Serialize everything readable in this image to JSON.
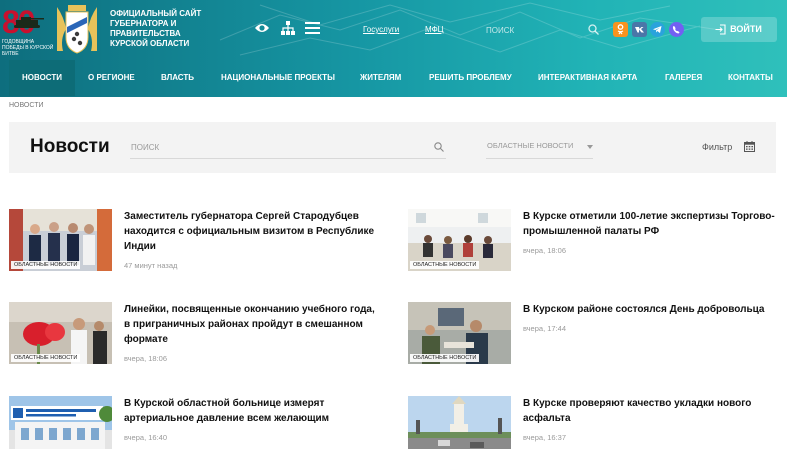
{
  "header": {
    "anniversary_number": "80",
    "anniversary_text": "ГОДОВЩИНА ПОБЕДЫ В КУРСКОЙ БИТВЕ",
    "site_title": "ОФИЦИАЛЬНЫЙ САЙТ ГУБЕРНАТОРА И ПРАВИТЕЛЬСТВА КУРСКОЙ ОБЛАСТИ",
    "links": [
      "Госуслуги",
      "МФЦ"
    ],
    "search_placeholder": "ПОИСК",
    "social_icons": [
      "odnoklassniki-icon",
      "vk-icon",
      "telegram-icon",
      "viber-icon"
    ],
    "social_colors": [
      "#f7931e",
      "#4a76a8",
      "#2aa3dc",
      "#7360f2"
    ],
    "login_label": "ВОЙТИ"
  },
  "nav": {
    "items": [
      "НОВОСТИ",
      "О РЕГИОНЕ",
      "ВЛАСТЬ",
      "НАЦИОНАЛЬНЫЕ ПРОЕКТЫ",
      "ЖИТЕЛЯМ",
      "РЕШИТЬ ПРОБЛЕМУ",
      "ИНТЕРАКТИВНАЯ КАРТА",
      "ГАЛЕРЕЯ",
      "КОНТАКТЫ"
    ],
    "active": "НОВОСТИ"
  },
  "breadcrumb": "НОВОСТИ",
  "filters": {
    "page_title": "Новости",
    "search_placeholder": "ПОИСК",
    "category_value": "ОБЛАСТНЫЕ НОВОСТИ",
    "filter_label": "Фильтр"
  },
  "news": [
    {
      "title": "Заместитель губернатора Сергей Стародубцев находится с официальным визитом в Республике Индии",
      "time": "47 минут назад",
      "badge": "ОБЛАСТНЫЕ НОВОСТИ"
    },
    {
      "title": "В Курске отметили 100-летие экспертизы Торгово-промышленной палаты РФ",
      "time": "вчера, 18:06",
      "badge": "ОБЛАСТНЫЕ НОВОСТИ"
    },
    {
      "title": "Линейки, посвященные окончанию учебного года, в приграничных районах пройдут в смешанном формате",
      "time": "вчера, 18:06",
      "badge": "ОБЛАСТНЫЕ НОВОСТИ"
    },
    {
      "title": "В Курском районе состоялся День добровольца",
      "time": "вчера, 17:44",
      "badge": "ОБЛАСТНЫЕ НОВОСТИ"
    },
    {
      "title": "В Курской областной больнице измерят артериальное давление всем желающим",
      "time": "вчера, 16:40",
      "badge": ""
    },
    {
      "title": "В Курске проверяют качество укладки нового асфальта",
      "time": "вчера, 16:37",
      "badge": ""
    }
  ],
  "colors": {
    "header_start": "#0e6e7e",
    "header_end": "#2fc0bb",
    "nav_active": "#0d6c77",
    "anniversary_red": "#c8102e"
  }
}
